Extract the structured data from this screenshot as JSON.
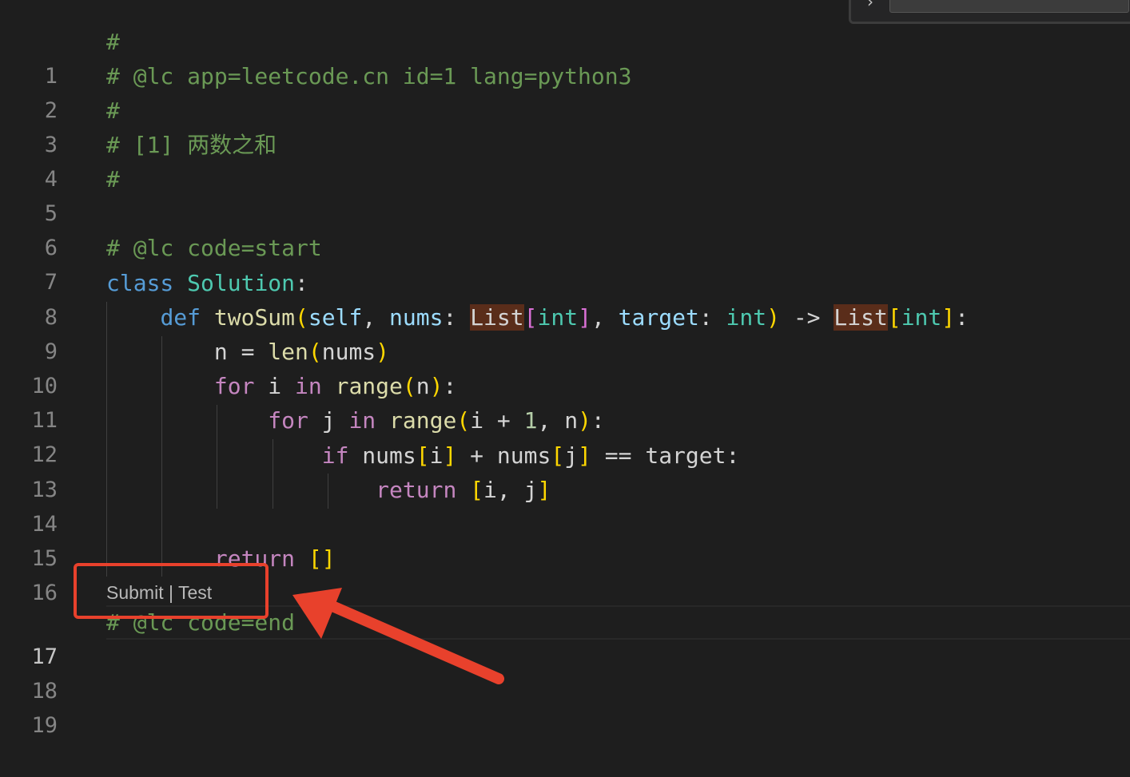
{
  "editor": {
    "line_numbers": [
      "1",
      "2",
      "3",
      "4",
      "5",
      "6",
      "7",
      "8",
      "9",
      "10",
      "11",
      "12",
      "13",
      "14",
      "15",
      "16",
      "17",
      "18",
      "19"
    ],
    "line1": "#",
    "line2": "# @lc app=leetcode.cn id=1 lang=python3",
    "line3": "#",
    "line4": "# [1] 两数之和",
    "line5": "#",
    "line7": "# @lc code=start",
    "line17": "# @lc code=end",
    "tokens": {
      "class_kw": "class",
      "class_name": "Solution",
      "colon": ":",
      "def_kw": "def",
      "fn_name": "twoSum",
      "self": "self",
      "comma": ",",
      "nums": "nums",
      "list_type": "List",
      "int_type": "int",
      "target": "target",
      "arrow": "->",
      "n": "n",
      "eq": "=",
      "len": "len",
      "for_kw": "for",
      "in_kw": "in",
      "range": "range",
      "i": "i",
      "j": "j",
      "plus": "+",
      "one": "1",
      "if_kw": "if",
      "eqeq": "==",
      "return_kw": "return",
      "lparen": "(",
      "rparen": ")",
      "lbrack": "[",
      "rbrack": "]"
    }
  },
  "codelens": {
    "submit": "Submit",
    "separator": " | ",
    "test": "Test"
  },
  "colors": {
    "background": "#1e1e1e",
    "annotation": "#e8412c"
  }
}
